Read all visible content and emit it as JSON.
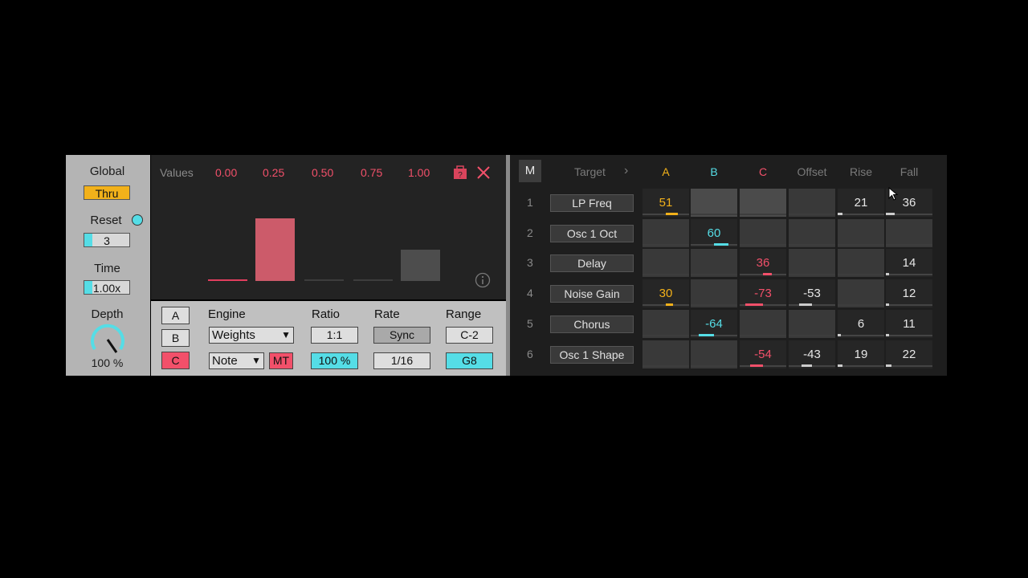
{
  "left": {
    "global_label": "Global",
    "global_value": "Thru",
    "reset_label": "Reset",
    "reset_value": "3",
    "time_label": "Time",
    "time_value": "1.00x",
    "depth_label": "Depth",
    "depth_value": "100 %"
  },
  "values": {
    "label": "Values",
    "marks": [
      "0.00",
      "0.25",
      "0.50",
      "0.75",
      "1.00"
    ],
    "bar_levels": [
      0.0,
      1.0,
      0.0,
      0.0,
      0.5
    ]
  },
  "engine": {
    "abc": [
      "A",
      "B",
      "C"
    ],
    "engine_label": "Engine",
    "engine_value": "Weights",
    "note_value": "Note",
    "mt_label": "MT",
    "ratio_label": "Ratio",
    "ratio_value": "1:1",
    "ratio_pct": "100 %",
    "rate_label": "Rate",
    "rate_sync": "Sync",
    "rate_value": "1/16",
    "range_label": "Range",
    "range_low": "C-2",
    "range_high": "G8"
  },
  "matrix": {
    "m_label": "M",
    "headers": {
      "target": "Target",
      "arrow": "›",
      "a": "A",
      "b": "B",
      "c": "C",
      "offset": "Offset",
      "rise": "Rise",
      "fall": "Fall"
    },
    "rows": [
      {
        "num": "1",
        "target": "LP Freq",
        "a": "51",
        "b": "",
        "c": "",
        "offset": "",
        "rise": "21",
        "fall": "36"
      },
      {
        "num": "2",
        "target": "Osc 1 Oct",
        "a": "",
        "b": "60",
        "c": "",
        "offset": "",
        "rise": "",
        "fall": ""
      },
      {
        "num": "3",
        "target": "Delay",
        "a": "",
        "b": "",
        "c": "36",
        "offset": "",
        "rise": "",
        "fall": "14"
      },
      {
        "num": "4",
        "target": "Noise Gain",
        "a": "30",
        "b": "",
        "c": "-73",
        "offset": "-53",
        "rise": "",
        "fall": "12"
      },
      {
        "num": "5",
        "target": "Chorus",
        "a": "",
        "b": "-64",
        "c": "",
        "offset": "",
        "rise": "6",
        "fall": "11"
      },
      {
        "num": "6",
        "target": "Osc 1 Shape",
        "a": "",
        "b": "",
        "c": "-54",
        "offset": "-43",
        "rise": "19",
        "fall": "22"
      }
    ]
  },
  "colors": {
    "yellow": "#f2b11a",
    "cyan": "#55dde6",
    "red": "#f2506a",
    "bar_red": "#cc5b6a"
  }
}
